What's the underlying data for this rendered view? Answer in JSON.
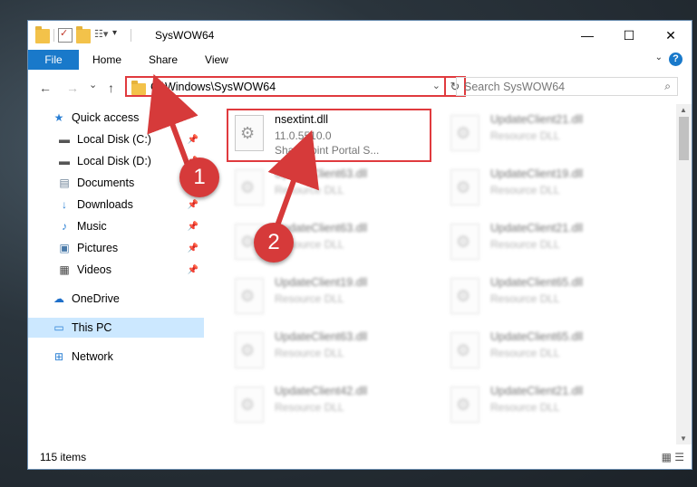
{
  "window": {
    "title": "SysWOW64",
    "controls": {
      "minimize": "—",
      "maximize": "☐",
      "close": "✕"
    }
  },
  "ribbon": {
    "file": "File",
    "tabs": [
      "Home",
      "Share",
      "View"
    ],
    "help": "?"
  },
  "navigation": {
    "back": "←",
    "forward": "→",
    "recent": "⌄",
    "up": "↑",
    "address": "C:\\Windows\\SysWOW64",
    "refresh": "↻",
    "search_placeholder": "Search SysWOW64"
  },
  "sidebar": {
    "items": [
      {
        "label": "Quick access",
        "icon": "star-icon",
        "pinned": false
      },
      {
        "label": "Local Disk (C:)",
        "icon": "drive-icon",
        "pinned": true
      },
      {
        "label": "Local Disk (D:)",
        "icon": "drive-icon",
        "pinned": true
      },
      {
        "label": "Documents",
        "icon": "document-icon",
        "pinned": true
      },
      {
        "label": "Downloads",
        "icon": "download-icon",
        "pinned": true
      },
      {
        "label": "Music",
        "icon": "music-icon",
        "pinned": true
      },
      {
        "label": "Pictures",
        "icon": "pictures-icon",
        "pinned": true
      },
      {
        "label": "Videos",
        "icon": "videos-icon",
        "pinned": true
      },
      {
        "label": "OneDrive",
        "icon": "cloud-icon",
        "pinned": false
      },
      {
        "label": "This PC",
        "icon": "computer-icon",
        "pinned": false,
        "selected": true
      },
      {
        "label": "Network",
        "icon": "network-icon",
        "pinned": false
      }
    ]
  },
  "files": [
    {
      "name": "nsextint.dll",
      "line2": "11.0.5510.0",
      "line3": "SharePoint Portal S...",
      "highlighted": true
    },
    {
      "name": "UpdateClient21.dll",
      "line2": "Resource DLL",
      "line3": ""
    },
    {
      "name": "UpdateClient63.dll",
      "line2": "Resource DLL",
      "line3": ""
    },
    {
      "name": "UpdateClient19.dll",
      "line2": "Resource DLL",
      "line3": ""
    },
    {
      "name": "UpdateClient63.dll",
      "line2": "Resource DLL",
      "line3": ""
    },
    {
      "name": "UpdateClient21.dll",
      "line2": "Resource DLL",
      "line3": ""
    },
    {
      "name": "UpdateClient19.dll",
      "line2": "Resource DLL",
      "line3": ""
    },
    {
      "name": "UpdateClient65.dll",
      "line2": "Resource DLL",
      "line3": ""
    },
    {
      "name": "UpdateClient63.dll",
      "line2": "Resource DLL",
      "line3": ""
    },
    {
      "name": "UpdateClient65.dll",
      "line2": "Resource DLL",
      "line3": ""
    },
    {
      "name": "UpdateClient42.dll",
      "line2": "Resource DLL",
      "line3": ""
    },
    {
      "name": "UpdateClient21.dll",
      "line2": "Resource DLL",
      "line3": ""
    }
  ],
  "status": {
    "item_count": "115 items"
  },
  "annotations": {
    "step1": "1",
    "step2": "2",
    "color": "#d63a3a"
  }
}
